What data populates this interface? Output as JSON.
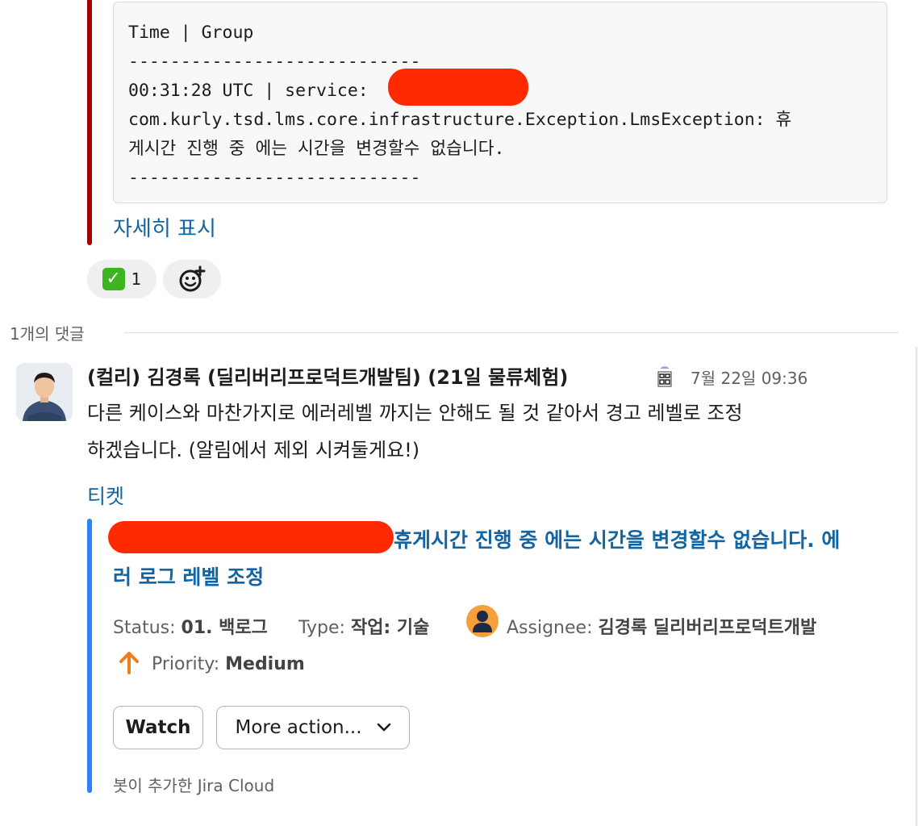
{
  "code_block": {
    "lines": [
      "Time | Group",
      "----------------------------",
      "00:31:28 UTC | service:",
      "com.kurly.tsd.lms.core.infrastructure.Exception.LmsException: 휴",
      "게시간 진행 중 에는 시간을 변경할수 없습니다.",
      "----------------------------"
    ]
  },
  "show_more_label": "자세히 표시",
  "reactions": [
    {
      "emoji": "✅",
      "count": "1"
    }
  ],
  "thread": {
    "reply_count_label": "1개의 댓글"
  },
  "message": {
    "author": "(컬리) 김경록 (딜리버리프로덕트개발팀) (21일 물류체험)",
    "timestamp": "7월 22일 09:36",
    "text_lines": [
      "다른 케이스와 마찬가지로 에러레벨 까지는 안해도 될 것 같아서  경고 레벨로 조정",
      "하겠습니다.  (알림에서 제외 시켜둘게요!)"
    ],
    "ticket_label": "티켓"
  },
  "jira_card": {
    "title_line1": "휴게시간 진행 중 에는 시간을 변경할수 없습니다. 에",
    "title_line2": "러 로그 레벨 조정",
    "status_label": "Status:",
    "status_value": "01. 백로그",
    "type_label": "Type:",
    "type_value": "작업: 기술",
    "assignee_label": "Assignee:",
    "assignee_value": "김경록 딜리버리프로덕트개발",
    "priority_label": "Priority:",
    "priority_value": "Medium",
    "watch_button": "Watch",
    "more_actions_button": "More action...",
    "footer": "봇이 추가한 Jira Cloud"
  },
  "colors": {
    "attachment_bar": "#a30200",
    "jira_bar": "#2a82f4",
    "link": "#1264a3",
    "redaction": "#ff2a00",
    "priority_medium": "#f07c1e"
  }
}
